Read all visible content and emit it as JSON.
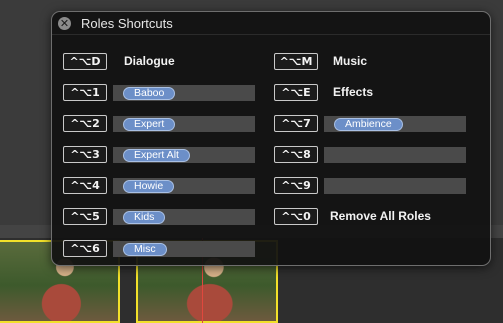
{
  "window": {
    "title": "Roles Shortcuts",
    "close_symbol": "✕"
  },
  "left_column": [
    {
      "shortcut": "^⌥D",
      "label": "Dialogue",
      "kind": "label"
    },
    {
      "shortcut": "^⌥1",
      "role": "Baboo",
      "kind": "role"
    },
    {
      "shortcut": "^⌥2",
      "role": "Expert",
      "kind": "role"
    },
    {
      "shortcut": "^⌥3",
      "role": "Expert Alt",
      "kind": "role"
    },
    {
      "shortcut": "^⌥4",
      "role": "Howie",
      "kind": "role"
    },
    {
      "shortcut": "^⌥5",
      "role": "Kids",
      "kind": "role"
    },
    {
      "shortcut": "^⌥6",
      "role": "Misc",
      "kind": "role"
    }
  ],
  "right_column": [
    {
      "shortcut": "^⌥M",
      "label": "Music",
      "kind": "label"
    },
    {
      "shortcut": "^⌥E",
      "label": "Effects",
      "kind": "label"
    },
    {
      "shortcut": "^⌥7",
      "role": "Ambience",
      "kind": "role"
    },
    {
      "shortcut": "^⌥8",
      "role": "",
      "kind": "empty"
    },
    {
      "shortcut": "^⌥9",
      "role": "",
      "kind": "empty"
    },
    {
      "shortcut": "^⌥0",
      "label": "Remove All Roles",
      "kind": "label"
    }
  ]
}
